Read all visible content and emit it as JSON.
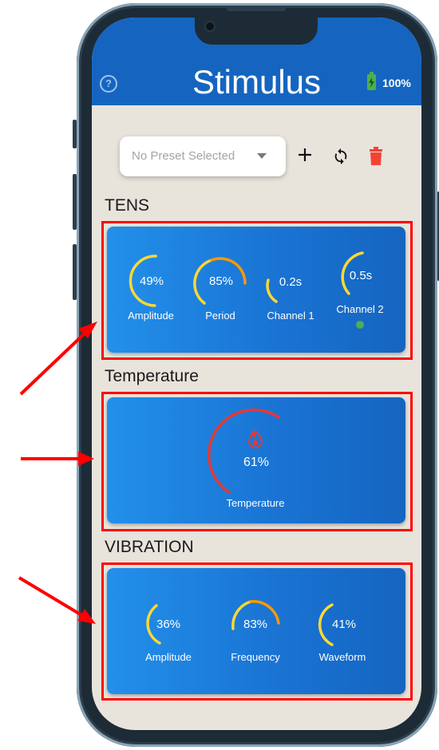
{
  "header": {
    "title": "Stimulus",
    "battery": "100%",
    "help_icon": "help-circle-icon",
    "battery_icon": "battery-charging-icon"
  },
  "preset": {
    "placeholder": "No Preset Selected",
    "add_icon": "plus-icon",
    "refresh_icon": "sync-icon",
    "delete_icon": "trash-icon"
  },
  "tens": {
    "title": "TENS",
    "gauges": [
      {
        "label": "Amplitude",
        "value": "49%"
      },
      {
        "label": "Period",
        "value": "85%"
      },
      {
        "label": "Channel 1",
        "value": "0.2s"
      },
      {
        "label": "Channel 2",
        "value": "0.5s"
      }
    ]
  },
  "temperature": {
    "title": "Temperature",
    "gauge": {
      "label": "Temperature",
      "value": "61%",
      "icon": "flame-icon"
    }
  },
  "vibration": {
    "title": "VIBRATION",
    "gauges": [
      {
        "label": "Amplitude",
        "value": "36%"
      },
      {
        "label": "Frequency",
        "value": "83%"
      },
      {
        "label": "Waveform",
        "value": "41%"
      }
    ]
  },
  "colors": {
    "header": "#1565c0",
    "gauge_yellow": "#fdd835",
    "gauge_orange": "#ff9800",
    "temperature_red": "#e53935",
    "delete_red": "#f44336",
    "status_green": "#4caf50",
    "annotation_red": "#ff0000"
  }
}
